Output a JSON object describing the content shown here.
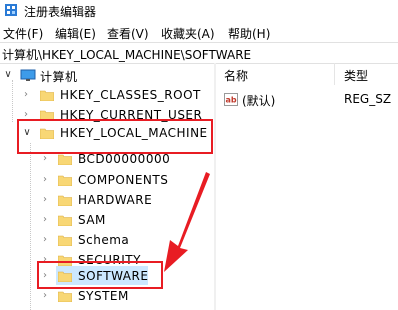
{
  "window": {
    "title": "注册表编辑器"
  },
  "menu": [
    {
      "label": "文件(F)"
    },
    {
      "label": "编辑(E)"
    },
    {
      "label": "查看(V)"
    },
    {
      "label": "收藏夹(A)"
    },
    {
      "label": "帮助(H)"
    }
  ],
  "address": {
    "path": "计算机\\HKEY_LOCAL_MACHINE\\SOFTWARE"
  },
  "tree": {
    "root": "计算机",
    "hives": [
      {
        "label": "HKEY_CLASSES_ROOT"
      },
      {
        "label": "HKEY_CURRENT_USER"
      },
      {
        "label": "HKEY_LOCAL_MACHINE"
      }
    ],
    "children": [
      {
        "label": "BCD00000000"
      },
      {
        "label": "COMPONENTS"
      },
      {
        "label": "HARDWARE"
      },
      {
        "label": "SAM"
      },
      {
        "label": "Schema"
      },
      {
        "label": "SECURITY"
      },
      {
        "label": "SOFTWARE"
      },
      {
        "label": "SYSTEM"
      }
    ]
  },
  "list": {
    "columns": [
      {
        "label": "名称"
      },
      {
        "label": "类型"
      }
    ],
    "rows": [
      {
        "name": "(默认)",
        "type": "REG_SZ"
      }
    ]
  },
  "colors": {
    "annotation": "#e81c23",
    "selection": "#cce8ff",
    "folder": "#f8d775"
  }
}
